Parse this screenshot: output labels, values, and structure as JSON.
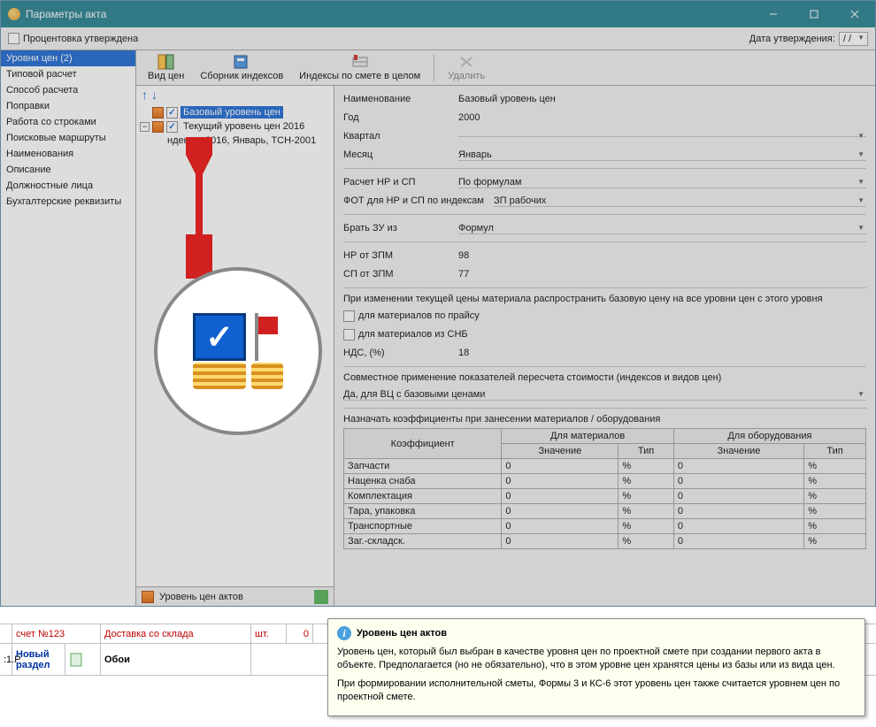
{
  "window": {
    "title": "Параметры акта"
  },
  "topbar": {
    "approved_label": "Процентовка утверждена",
    "date_label": "Дата утверждения:",
    "date_value": "/  /"
  },
  "sidebar": {
    "items": [
      "Уровни цен (2)",
      "Типовой расчет",
      "Способ расчета",
      "Поправки",
      "Работа со строками",
      "Поисковые маршруты",
      "Наименования",
      "Описание",
      "Должностные лица",
      "Бухгалтерские реквизиты"
    ]
  },
  "toolbar": {
    "view": "Вид цен",
    "collection": "Сборник индексов",
    "indexes": "Индексы по смете в целом",
    "delete": "Удалить"
  },
  "tree": {
    "base": "Базовый уровень цен",
    "current": "Текущий уровень цен 2016",
    "idx": "ндексы: 2016, Январь, ТСН-2001"
  },
  "props": {
    "name_label": "Наименование",
    "name_val": "Базовый уровень цен",
    "year_label": "Год",
    "year_val": "2000",
    "quarter_label": "Квартал",
    "month_label": "Месяц",
    "month_val": "Январь",
    "calc_label": "Расчет НР и СП",
    "calc_val": "По формулам",
    "fot_label": "ФОТ для НР и СП по индексам",
    "fot_val": "ЗП рабочих",
    "zu_label": "Брать ЗУ из",
    "zu_val": "Формул",
    "nr_label": "НР от ЗПМ",
    "nr_val": "98",
    "sp_label": "СП от ЗПМ",
    "sp_val": "77",
    "spread_heading": "При изменении текущей цены материала распространить базовую цену на все уровни цен с этого уровня",
    "mat_price": "для материалов по прайсу",
    "mat_snb": "для материалов из СНБ",
    "nds_label": "НДС, (%)",
    "nds_val": "18",
    "combine_heading": "Совместное применение показателей пересчета стоимости (индексов и видов цен)",
    "combine_val": "Да, для ВЦ с базовыми ценами",
    "koef_heading": "Назначать коэффициенты при занесении материалов / оборудования"
  },
  "ktable": {
    "headers": {
      "koef": "Коэффициент",
      "mat": "Для материалов",
      "oboru": "Для оборудования",
      "val": "Значение",
      "type": "Тип"
    },
    "rows": [
      {
        "name": "Запчасти",
        "mv": "0",
        "mt": "%",
        "ov": "0",
        "ot": "%"
      },
      {
        "name": "Наценка снаба",
        "mv": "0",
        "mt": "%",
        "ov": "0",
        "ot": "%"
      },
      {
        "name": "Комплектация",
        "mv": "0",
        "mt": "%",
        "ov": "0",
        "ot": "%"
      },
      {
        "name": "Тара, упаковка",
        "mv": "0",
        "mt": "%",
        "ov": "0",
        "ot": "%"
      },
      {
        "name": "Транспортные",
        "mv": "0",
        "mt": "%",
        "ov": "0",
        "ot": "%"
      },
      {
        "name": "Заг.-складск.",
        "mv": "0",
        "mt": "%",
        "ov": "0",
        "ot": "%"
      }
    ]
  },
  "statusbar": {
    "text": "Уровень цен актов"
  },
  "grid": {
    "row1": {
      "c1": "счет №123",
      "c2": "Доставка со склада",
      "c3": "шт.",
      "c4": "0"
    },
    "row2": {
      "c0": ":1.Р",
      "c1": "Новый раздел",
      "c2": "Обои"
    }
  },
  "tooltip": {
    "title": "Уровень цен актов",
    "p1": "Уровень цен, который был выбран в качестве уровня цен по проектной смете при создании первого акта в объекте. Предполагается (но не обязательно), что в этом уровне цен хранятся цены из базы или из вида цен.",
    "p2": "При формировании исполнительной сметы, Формы 3 и КС-6 этот уровень цен также считается уровнем цен по проектной смете."
  }
}
